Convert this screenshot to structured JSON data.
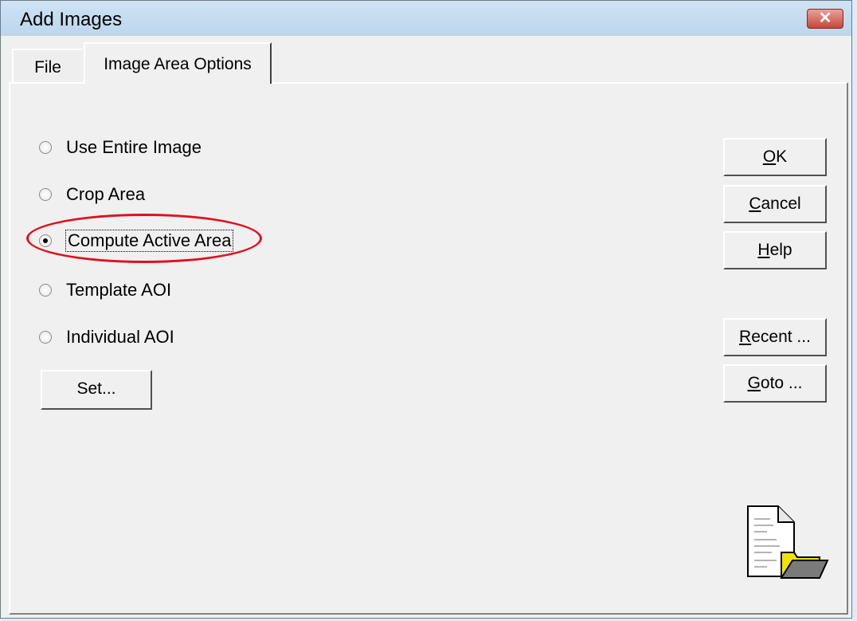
{
  "window": {
    "title": "Add Images",
    "close_glyph": "✕"
  },
  "tabs": [
    {
      "label": "File"
    },
    {
      "label": "Image Area Options"
    }
  ],
  "options": [
    {
      "label": "Use Entire Image",
      "checked": false
    },
    {
      "label": "Crop Area",
      "checked": false
    },
    {
      "label": "Compute Active Area",
      "checked": true
    },
    {
      "label": "Template AOI",
      "checked": false
    },
    {
      "label": "Individual AOI",
      "checked": false
    }
  ],
  "set_button": "Set...",
  "buttons": {
    "ok": {
      "mnemonic": "O",
      "rest": "K"
    },
    "cancel": {
      "mnemonic": "C",
      "rest": "ancel"
    },
    "help": {
      "mnemonic": "H",
      "rest": "elp"
    },
    "recent": {
      "mnemonic": "R",
      "rest": "ecent ..."
    },
    "goto": {
      "mnemonic": "G",
      "rest": "oto ..."
    }
  },
  "icons": {
    "corner": "document-folder-icon"
  },
  "colors": {
    "highlight": "#e0101c",
    "folder": "#f2e200"
  }
}
